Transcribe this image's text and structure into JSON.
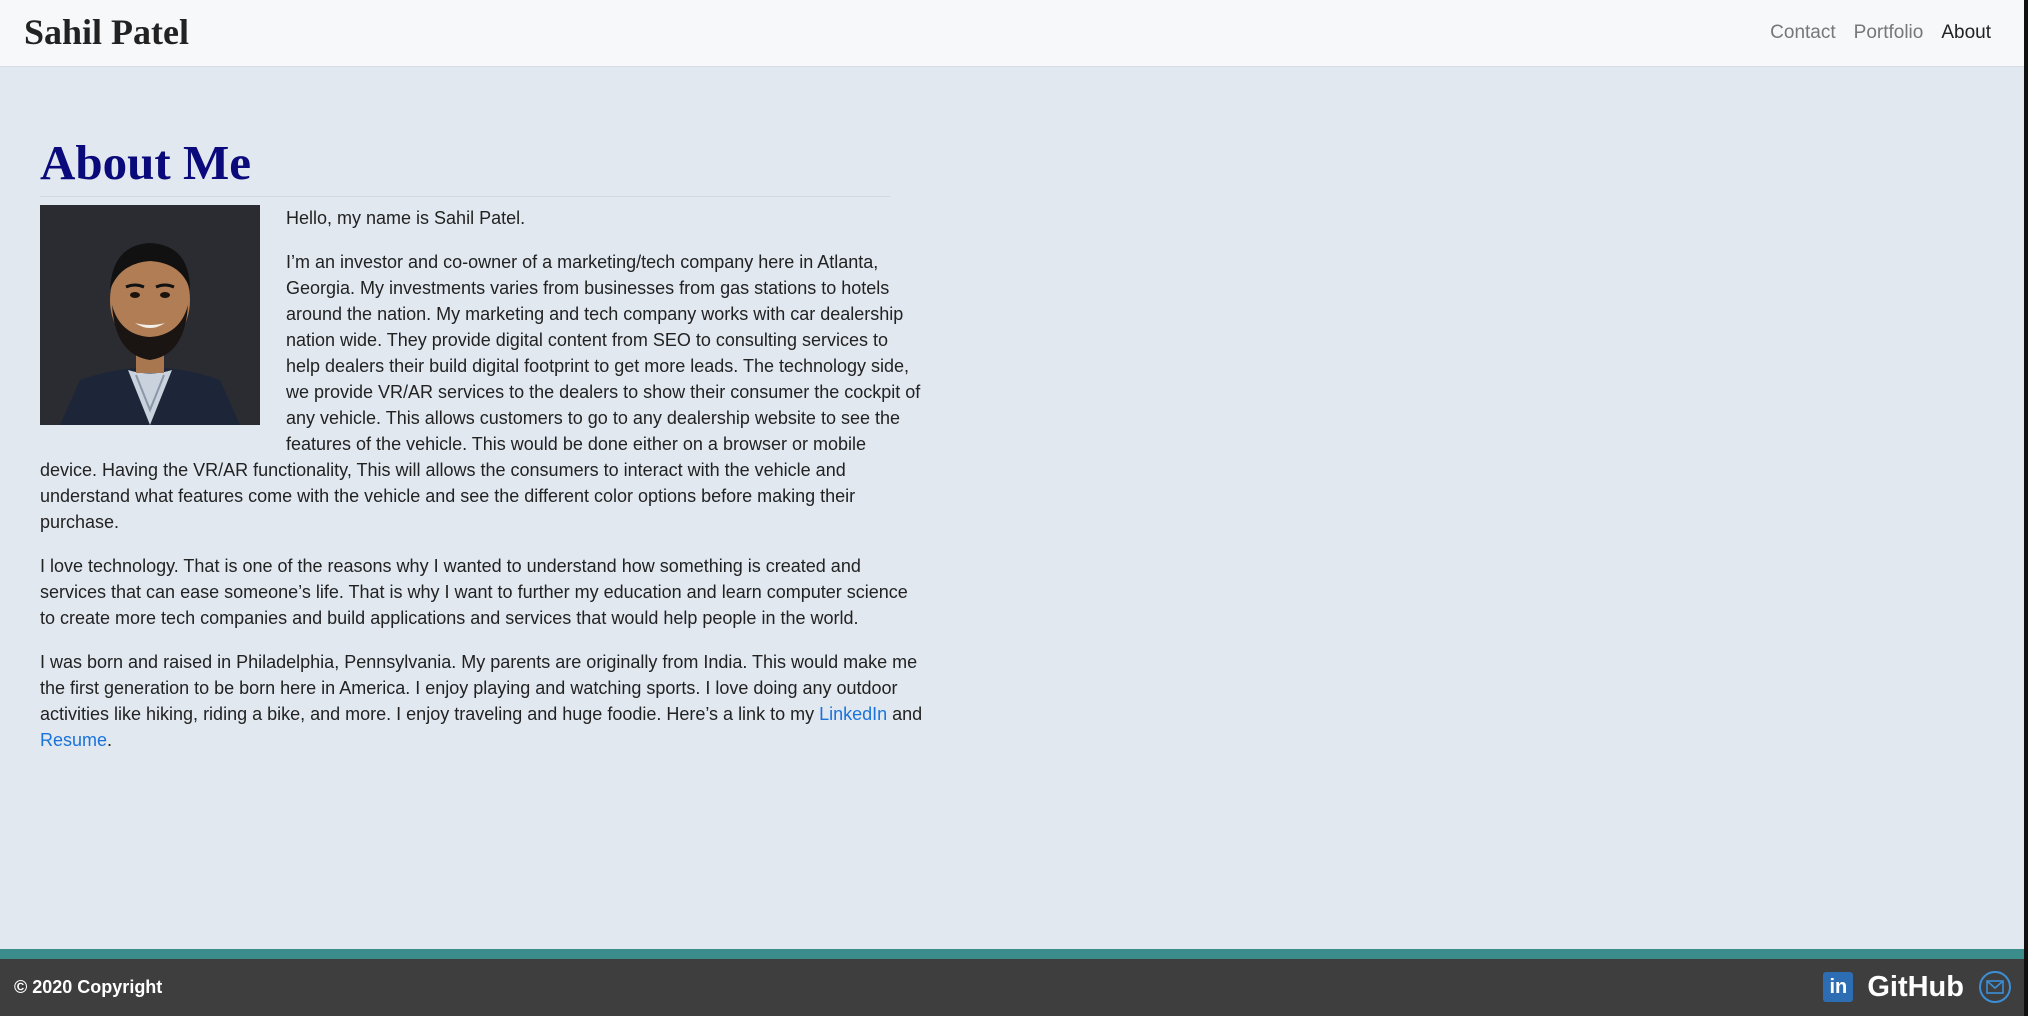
{
  "nav": {
    "brand": "Sahil Patel",
    "links": [
      "Contact",
      "Portfolio",
      "About"
    ],
    "active": "About"
  },
  "about": {
    "title": "About Me",
    "portrait_alt": "Portrait photo",
    "p1": "Hello, my name is Sahil Patel.",
    "p2": "I’m an investor and co-owner of a marketing/tech company here in Atlanta, Georgia. My investments varies from businesses from gas stations to hotels around the nation. My marketing and tech company works with car dealership nation wide. They provide digital content from SEO to consulting services to help dealers their build digital footprint to get more leads. The technology side, we provide VR/AR services to the dealers to show their consumer the cockpit of any vehicle. This allows customers to go to any dealership website to see the features of the vehicle. This would be done either on a browser or mobile device. Having the VR/AR functionality, This will allows the consumers to interact with the vehicle and understand what features come with the vehicle and see the different color options before making their purchase.",
    "p3": "I love technology. That is one of the reasons why I wanted to understand how something is created and services that can ease someone’s life. That is why I want to further my education and learn computer science to create more tech companies and build applications and services that would help people in the world.",
    "p4_before": "I was born and raised in Philadelphia, Pennsylvania. My parents are originally from India. This would make me the first generation to be born here in America. I enjoy playing and watching sports. I love doing any outdoor activities like hiking, riding a bike, and more. I enjoy traveling and huge foodie. Here’s a link to my ",
    "linkedin_link": "LinkedIn",
    "p4_middle": " and ",
    "resume_link": "Resume",
    "p4_end": "."
  },
  "footer": {
    "copyright": "© 2020 Copyright",
    "linkedin_icon": "in",
    "github": "GitHub",
    "icons": [
      "linkedin-icon",
      "github-icon",
      "mail-icon"
    ]
  },
  "colors": {
    "background": "#e1e8f0",
    "title": "#0a0a7a",
    "link": "#1a73d9",
    "footer": "#3e3e3e",
    "footer_stripe": "#3a8d8b"
  }
}
